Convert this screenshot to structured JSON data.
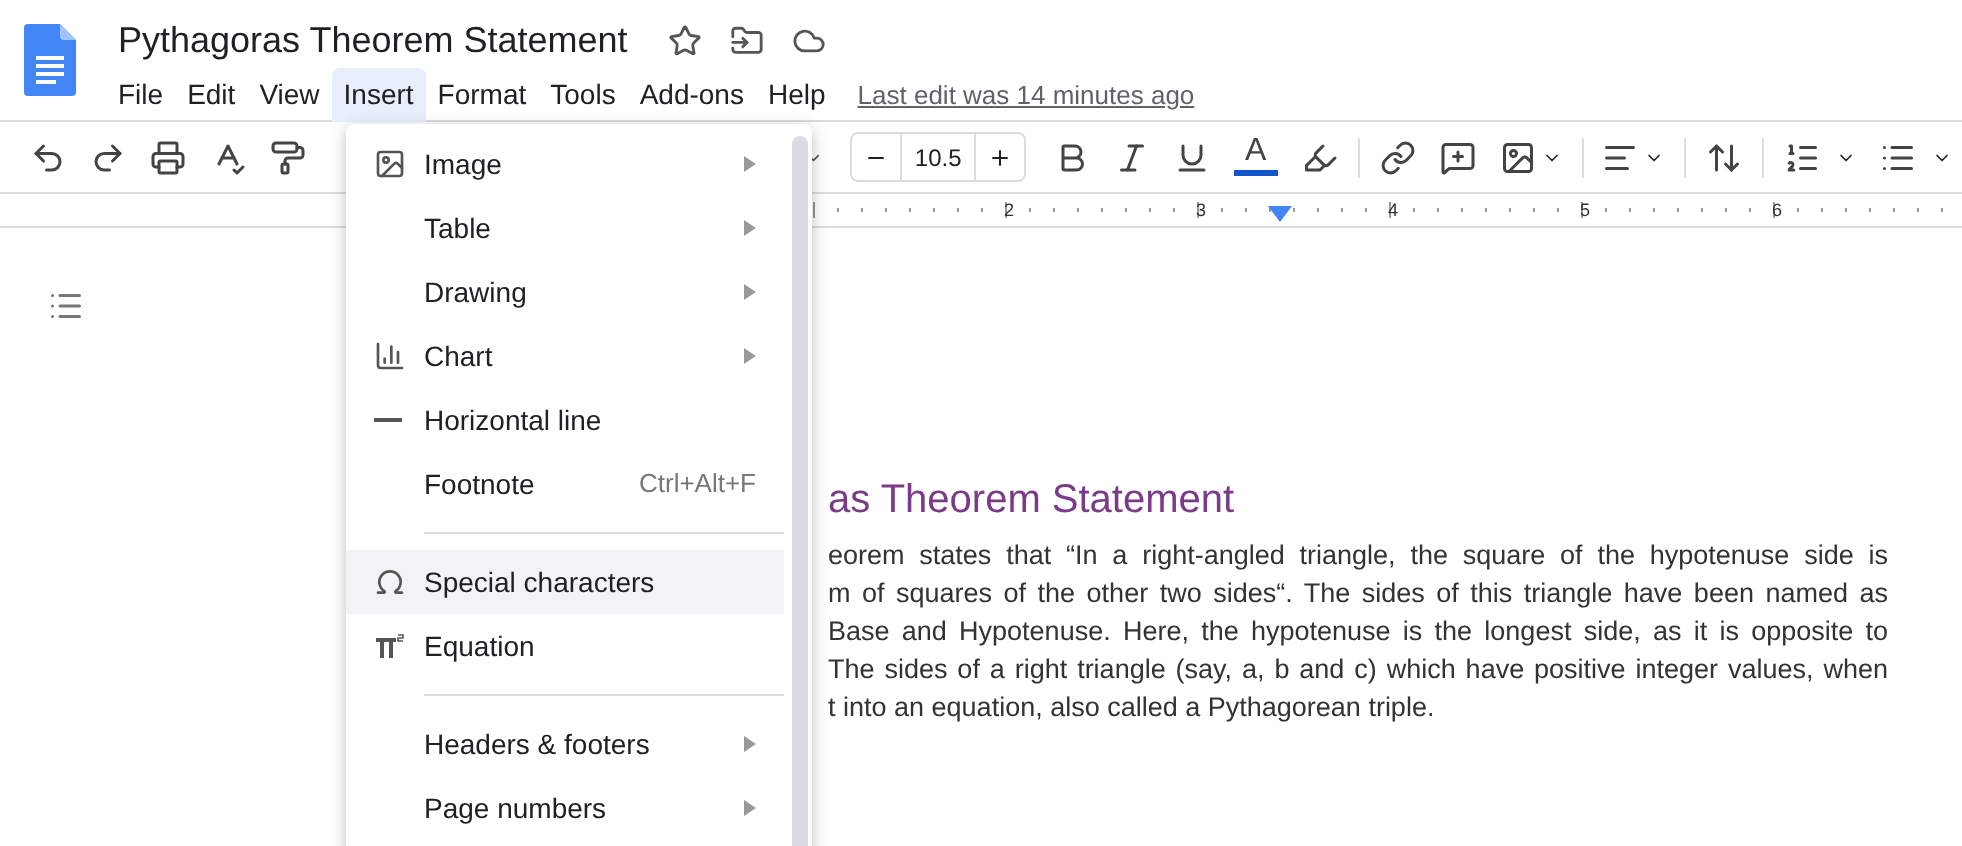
{
  "document": {
    "title": "Pythagoras Theorem Statement"
  },
  "menu_bar": [
    {
      "label": "File",
      "selected": false
    },
    {
      "label": "Edit",
      "selected": false
    },
    {
      "label": "View",
      "selected": false
    },
    {
      "label": "Insert",
      "selected": true
    },
    {
      "label": "Format",
      "selected": false
    },
    {
      "label": "Tools",
      "selected": false
    },
    {
      "label": "Add-ons",
      "selected": false
    },
    {
      "label": "Help",
      "selected": false
    }
  ],
  "last_edit": "Last edit was 14 minutes ago",
  "toolbar": {
    "font_size": "10.5",
    "text_color_label": "A"
  },
  "ruler": [
    "2",
    "3",
    "4",
    "5",
    "6"
  ],
  "insert_menu": [
    {
      "kind": "item",
      "label": "Image",
      "submenu": true,
      "selected": false
    },
    {
      "kind": "item",
      "label": "Table",
      "submenu": true,
      "selected": false
    },
    {
      "kind": "item",
      "label": "Drawing",
      "submenu": true,
      "selected": false
    },
    {
      "kind": "item",
      "label": "Chart",
      "submenu": true,
      "selected": false
    },
    {
      "kind": "item",
      "label": "Horizontal line",
      "submenu": false,
      "selected": false
    },
    {
      "kind": "item",
      "label": "Footnote",
      "shortcut": "Ctrl+Alt+F",
      "submenu": false,
      "selected": false
    },
    {
      "kind": "separator"
    },
    {
      "kind": "item",
      "label": "Special characters",
      "submenu": false,
      "selected": true
    },
    {
      "kind": "item",
      "label": "Equation",
      "submenu": false,
      "selected": false
    },
    {
      "kind": "separator"
    },
    {
      "kind": "item",
      "label": "Headers & footers",
      "submenu": true,
      "selected": false
    },
    {
      "kind": "item",
      "label": "Page numbers",
      "submenu": true,
      "selected": false
    }
  ],
  "page": {
    "heading": "as Theorem Statement",
    "lines": [
      "eorem states that “In a right-angled triangle,  the square of the hypotenuse side is",
      "m of squares of the other two sides“. The sides of this triangle have been named as",
      "Base and Hypotenuse. Here, the hypotenuse is the longest side, as it is opposite to",
      "The sides of a right triangle (say, a, b and c) which have positive integer values, when",
      "t into an equation, also called a Pythagorean triple."
    ]
  }
}
